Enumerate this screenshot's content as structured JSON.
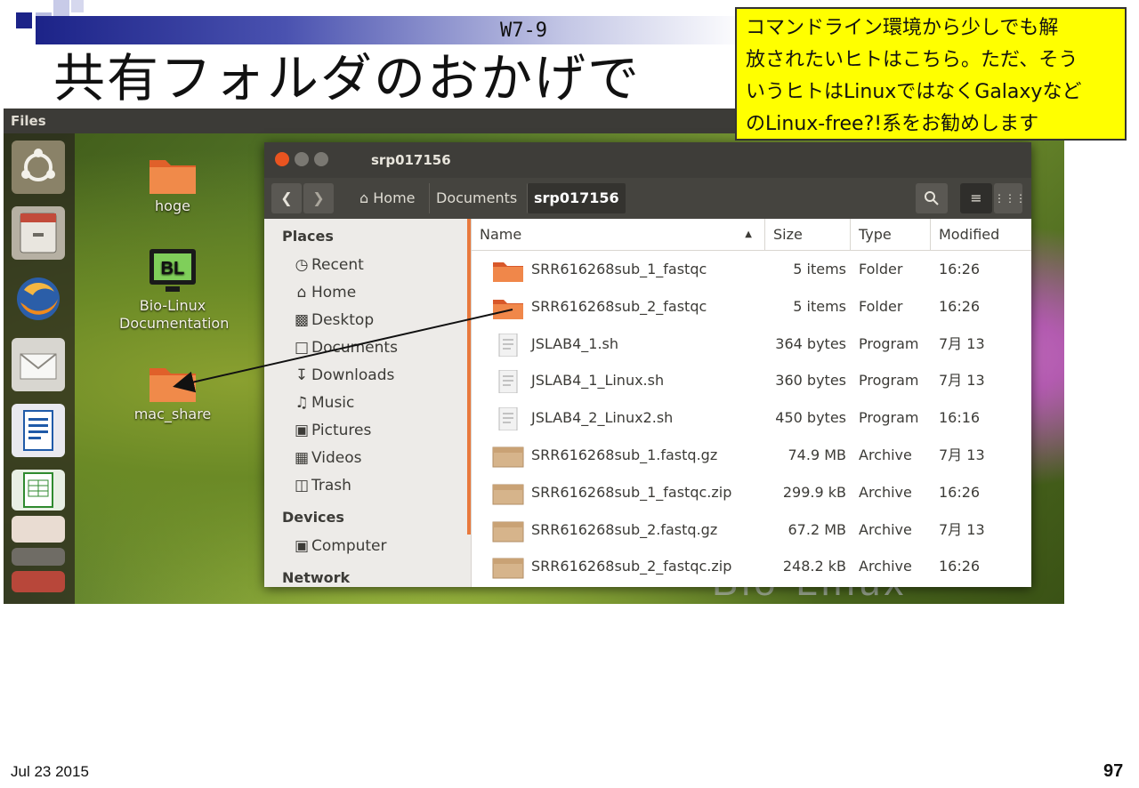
{
  "slide": {
    "id": "W7-9",
    "title": "共有フォルダのおかげで",
    "callout": [
      "コマンドライン環境から少しでも解",
      "放されたいヒトはこちら。ただ、そう",
      "いうヒトはLinuxではなくGalaxyなど",
      "のLinux-free?!系をお勧めします"
    ],
    "date": "Jul 23 2015",
    "page": "97"
  },
  "desktop": {
    "topbar_title": "Files",
    "icons": [
      {
        "label": "hoge",
        "icon": "folder-icon"
      },
      {
        "label": "Bio-Linux Documentation",
        "icon": "bl-monitor-icon",
        "monitor_text": "BL"
      },
      {
        "label": "mac_share",
        "icon": "folder-icon"
      }
    ],
    "watermark": "Bio-Linux"
  },
  "window": {
    "title": "srp017156",
    "breadcrumb": [
      "Home",
      "Documents",
      "srp017156"
    ],
    "sidebar": {
      "places_header": "Places",
      "places": [
        {
          "label": "Recent",
          "icon": "clock-icon"
        },
        {
          "label": "Home",
          "icon": "home-icon"
        },
        {
          "label": "Desktop",
          "icon": "desktop-icon"
        },
        {
          "label": "Documents",
          "icon": "document-icon"
        },
        {
          "label": "Downloads",
          "icon": "download-icon"
        },
        {
          "label": "Music",
          "icon": "music-icon"
        },
        {
          "label": "Pictures",
          "icon": "camera-icon"
        },
        {
          "label": "Videos",
          "icon": "film-icon"
        },
        {
          "label": "Trash",
          "icon": "trash-icon"
        }
      ],
      "devices_header": "Devices",
      "devices": [
        {
          "label": "Computer",
          "icon": "drive-icon"
        }
      ],
      "network_header": "Network"
    },
    "columns": {
      "name": "Name",
      "size": "Size",
      "type": "Type",
      "modified": "Modified",
      "sort_indicator": "▲"
    },
    "files": [
      {
        "name": "SRR616268sub_1_fastqc",
        "size": "5 items",
        "type": "Folder",
        "modified": "16:26",
        "kind": "folder"
      },
      {
        "name": "SRR616268sub_2_fastqc",
        "size": "5 items",
        "type": "Folder",
        "modified": "16:26",
        "kind": "folder"
      },
      {
        "name": "JSLAB4_1.sh",
        "size": "364 bytes",
        "type": "Program",
        "modified": "7月 13",
        "kind": "script"
      },
      {
        "name": "JSLAB4_1_Linux.sh",
        "size": "360 bytes",
        "type": "Program",
        "modified": "7月 13",
        "kind": "script"
      },
      {
        "name": "JSLAB4_2_Linux2.sh",
        "size": "450 bytes",
        "type": "Program",
        "modified": "16:16",
        "kind": "script"
      },
      {
        "name": "SRR616268sub_1.fastq.gz",
        "size": "74.9 MB",
        "type": "Archive",
        "modified": "7月 13",
        "kind": "archive"
      },
      {
        "name": "SRR616268sub_1_fastqc.zip",
        "size": "299.9 kB",
        "type": "Archive",
        "modified": "16:26",
        "kind": "archive"
      },
      {
        "name": "SRR616268sub_2.fastq.gz",
        "size": "67.2 MB",
        "type": "Archive",
        "modified": "7月 13",
        "kind": "archive"
      },
      {
        "name": "SRR616268sub_2_fastqc.zip",
        "size": "248.2 kB",
        "type": "Archive",
        "modified": "16:26",
        "kind": "archive"
      }
    ]
  },
  "colors": {
    "accent": "#e8793d",
    "callout_bg": "#ffff00",
    "titlebar": "#3e3d39"
  }
}
